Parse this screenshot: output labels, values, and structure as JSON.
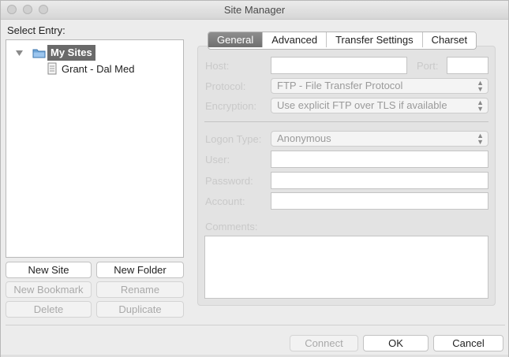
{
  "window": {
    "title": "Site Manager"
  },
  "select_entry_label": "Select Entry:",
  "tree": {
    "root": {
      "label": "My Sites",
      "expanded": true,
      "icon": "folder-icon"
    },
    "children": [
      {
        "label": "Grant - Dal Med",
        "icon": "site-icon"
      }
    ]
  },
  "left_buttons": {
    "new_site": "New Site",
    "new_folder": "New Folder",
    "new_bookmark": "New Bookmark",
    "rename": "Rename",
    "delete": "Delete",
    "duplicate": "Duplicate"
  },
  "tabs": [
    {
      "label": "General",
      "active": true
    },
    {
      "label": "Advanced"
    },
    {
      "label": "Transfer Settings"
    },
    {
      "label": "Charset"
    }
  ],
  "general": {
    "host_label": "Host:",
    "host_value": "",
    "port_label": "Port:",
    "port_value": "",
    "protocol_label": "Protocol:",
    "protocol_value": "FTP - File Transfer Protocol",
    "encryption_label": "Encryption:",
    "encryption_value": "Use explicit FTP over TLS if available",
    "logon_type_label": "Logon Type:",
    "logon_type_value": "Anonymous",
    "user_label": "User:",
    "user_value": "",
    "password_label": "Password:",
    "password_value": "",
    "account_label": "Account:",
    "account_value": "",
    "comments_label": "Comments:",
    "comments_value": ""
  },
  "footer": {
    "connect": "Connect",
    "ok": "OK",
    "cancel": "Cancel"
  },
  "colors": {
    "selection": "#6a6a6a",
    "active_tab": "#7a7a7a",
    "window_bg": "#ececec"
  }
}
